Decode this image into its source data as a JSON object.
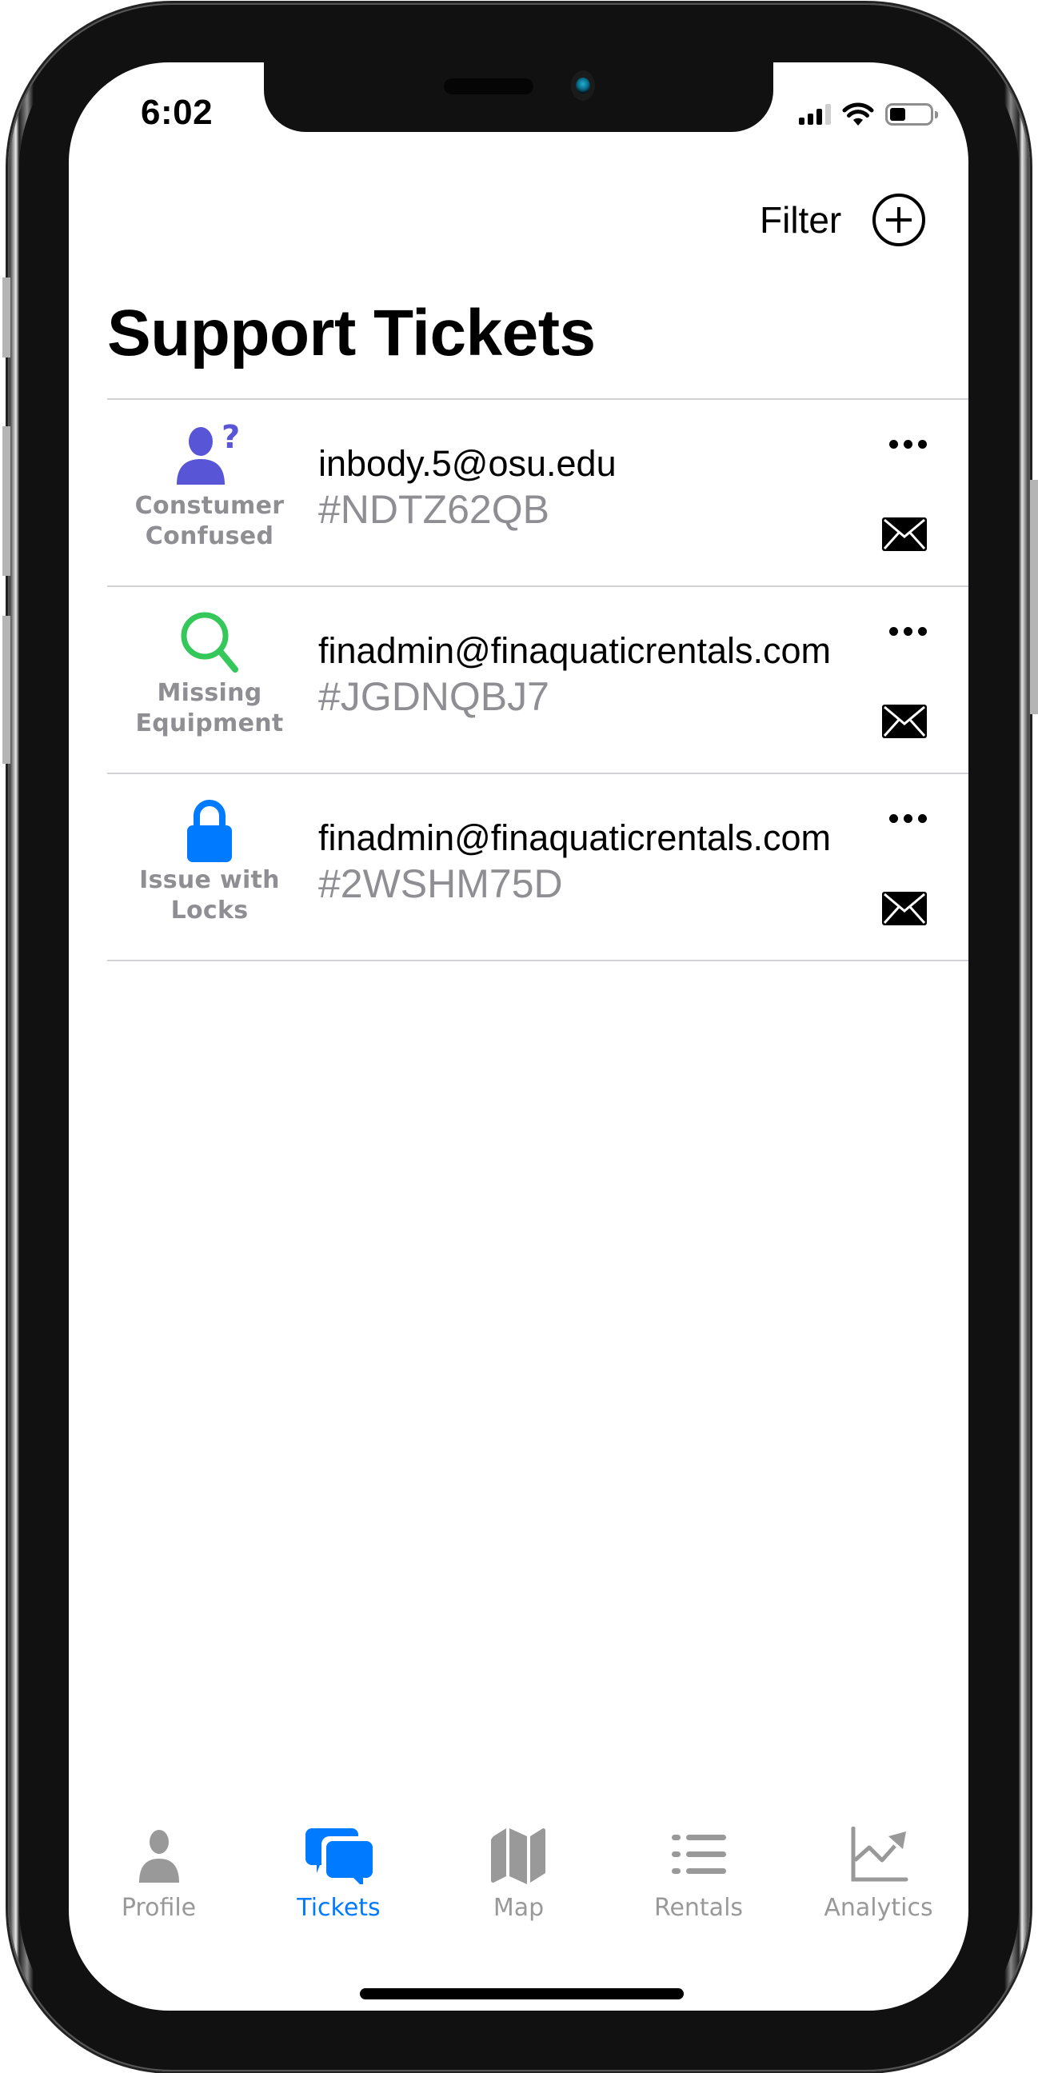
{
  "status_bar": {
    "time": "6:02",
    "signal_bars_filled": 3,
    "signal_bars_total": 4,
    "battery_level": 0.4
  },
  "header": {
    "filter_label": "Filter",
    "add_icon": "plus-circle-icon",
    "title": "Support Tickets"
  },
  "tickets": [
    {
      "category_label": "Constumer Confused",
      "category_icon": "person-question-icon",
      "category_color": "#5856d6",
      "email": "inbody.5@osu.edu",
      "ticket_id": "#NDTZ62QB"
    },
    {
      "category_label": "Missing Equipment",
      "category_icon": "magnifying-glass-icon",
      "category_color": "#34c759",
      "email": "finadmin@finaquaticrentals.com",
      "ticket_id": "#JGDNQBJ7"
    },
    {
      "category_label": "Issue with Locks",
      "category_icon": "lock-icon",
      "category_color": "#007aff",
      "email": "finadmin@finaquaticrentals.com",
      "ticket_id": "#2WSHM75D"
    }
  ],
  "tabbar": {
    "active_color": "#007aff",
    "inactive_color": "#999999",
    "tabs": [
      {
        "label": "Profile",
        "icon": "person-icon",
        "active": false
      },
      {
        "label": "Tickets",
        "icon": "chat-bubbles-icon",
        "active": true
      },
      {
        "label": "Map",
        "icon": "map-icon",
        "active": false
      },
      {
        "label": "Rentals",
        "icon": "list-icon",
        "active": false
      },
      {
        "label": "Analytics",
        "icon": "chart-line-icon",
        "active": false
      }
    ]
  }
}
